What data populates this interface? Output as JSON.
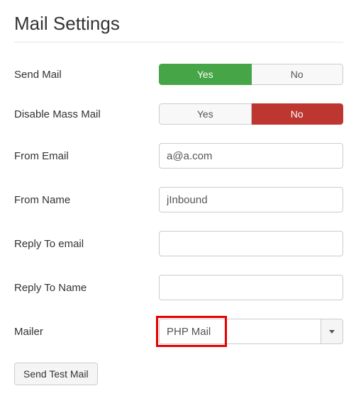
{
  "title": "Mail Settings",
  "fields": {
    "send_mail": {
      "label": "Send Mail",
      "yes": "Yes",
      "no": "No",
      "value": "yes"
    },
    "disable_mass_mail": {
      "label": "Disable Mass Mail",
      "yes": "Yes",
      "no": "No",
      "value": "no"
    },
    "from_email": {
      "label": "From Email",
      "value": "a@a.com"
    },
    "from_name": {
      "label": "From Name",
      "value": "jInbound"
    },
    "reply_to_email": {
      "label": "Reply To email",
      "value": ""
    },
    "reply_to_name": {
      "label": "Reply To Name",
      "value": ""
    },
    "mailer": {
      "label": "Mailer",
      "selected": "PHP Mail"
    }
  },
  "buttons": {
    "send_test": "Send Test Mail"
  }
}
